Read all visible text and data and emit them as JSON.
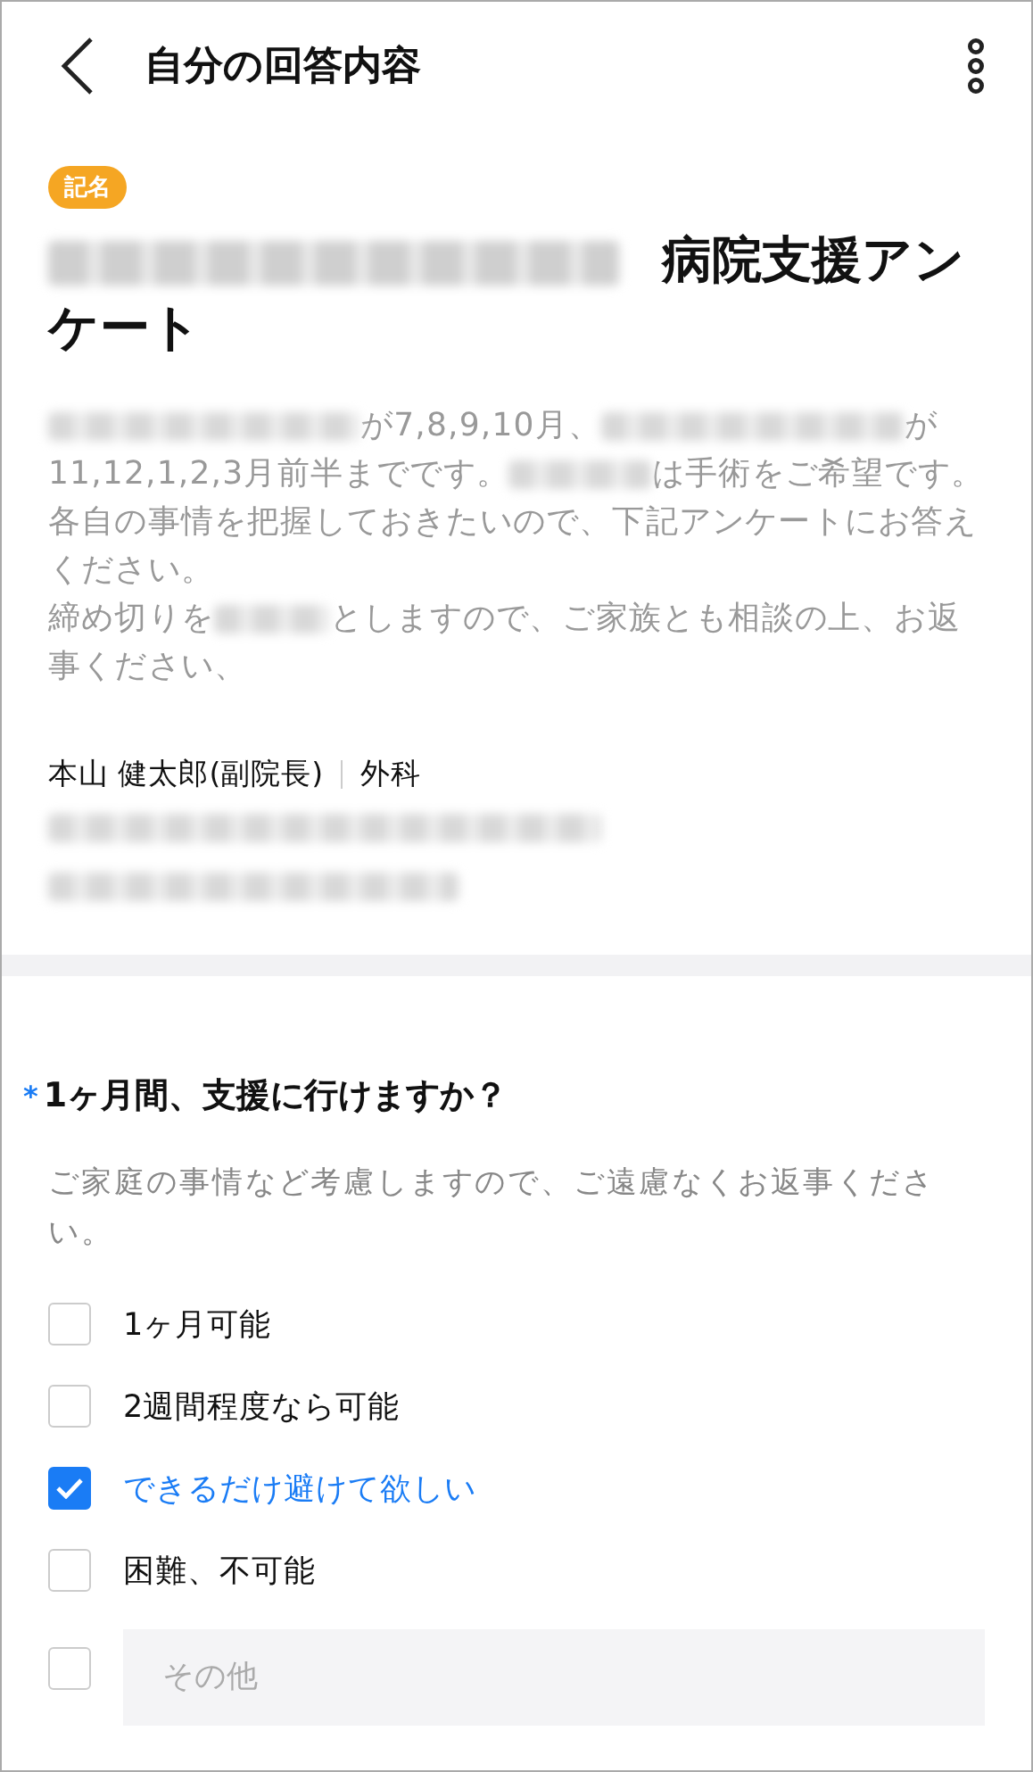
{
  "header": {
    "title": "自分の回答内容"
  },
  "survey": {
    "badge": "記名",
    "title": [
      {
        "kind": "blur"
      },
      {
        "kind": "text",
        "text": "病院支援アンケート"
      }
    ],
    "description": [
      [
        {
          "kind": "blur"
        },
        {
          "kind": "text",
          "text": "が7,8,9,10月、"
        },
        {
          "kind": "blur"
        },
        {
          "kind": "text",
          "text": "が11,12,1,2,3月前半までです。"
        },
        {
          "kind": "blur"
        },
        {
          "kind": "text",
          "text": "は手術をご希望です。各自の事情を把握しておきたいので、下記アンケートにお答えください。"
        }
      ],
      [
        {
          "kind": "text",
          "text": "締め切りを"
        },
        {
          "kind": "blur"
        },
        {
          "kind": "text",
          "text": "としますので、ご家族とも相談の上、お返事ください、"
        }
      ]
    ],
    "author": {
      "name": "本山 健太郎(副院長)",
      "department": "外科"
    },
    "meta_lines": [
      {
        "kind": "blur"
      },
      {
        "kind": "blur"
      }
    ]
  },
  "question": {
    "required_mark": "*",
    "text": "1ヶ月間、支援に行けますか？",
    "hint": "ご家庭の事情など考慮しますので、ご遠慮なくお返事ください。",
    "options": [
      {
        "kind": "checkbox",
        "label": "1ヶ月可能",
        "checked": false
      },
      {
        "kind": "checkbox",
        "label": "2週間程度なら可能",
        "checked": false
      },
      {
        "kind": "checkbox",
        "label": "できるだけ避けて欲しい",
        "checked": true
      },
      {
        "kind": "checkbox",
        "label": "困難、不可能",
        "checked": false
      },
      {
        "kind": "other",
        "placeholder": "その他",
        "checked": false
      }
    ]
  }
}
